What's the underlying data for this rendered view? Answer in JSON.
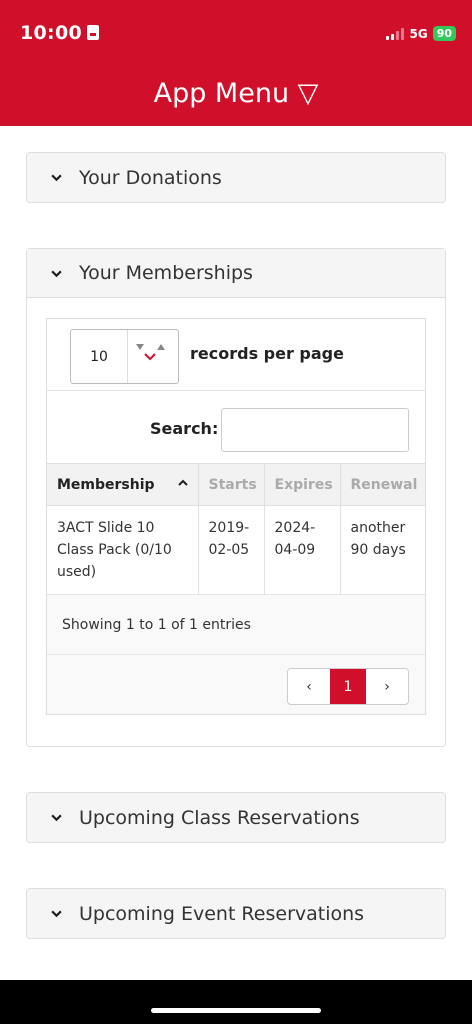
{
  "status": {
    "time": "10:00",
    "network": "5G",
    "battery": "90"
  },
  "header": {
    "title": "App Menu ▽"
  },
  "panels": {
    "donations": {
      "label": "Your Donations"
    },
    "memberships": {
      "label": "Your Memberships"
    },
    "class_reservations": {
      "label": "Upcoming Class Reservations"
    },
    "event_reservations": {
      "label": "Upcoming Event Reservations"
    }
  },
  "table": {
    "page_length": {
      "value": "10",
      "label": "records per page"
    },
    "search": {
      "label": "Search:",
      "value": ""
    },
    "columns": [
      "Membership",
      "Starts",
      "Expires",
      "Renewal"
    ],
    "rows": [
      {
        "membership": "3ACT Slide 10 Class Pack (0/10 used)",
        "starts": "2019-02-05",
        "expires": "2024-04-09",
        "renewal": "another 90 days"
      }
    ],
    "info": "Showing 1 to 1 of 1 entries",
    "pagination": {
      "prev": "‹",
      "current": "1",
      "next": "›"
    }
  },
  "colors": {
    "brand": "#d0102a"
  }
}
